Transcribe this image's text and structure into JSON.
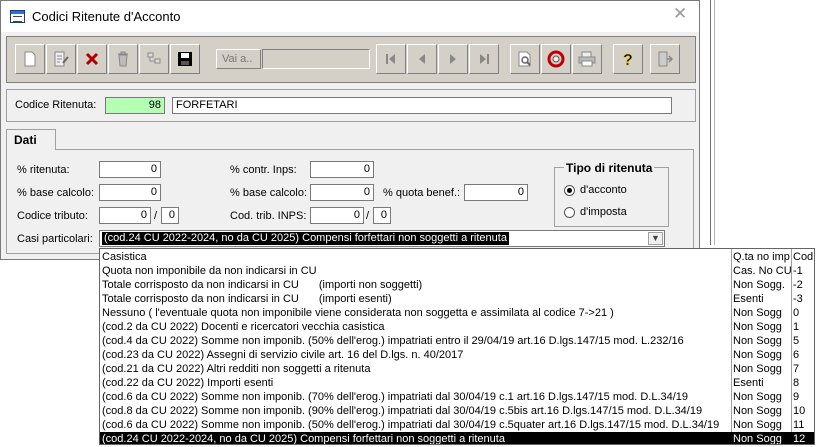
{
  "window": {
    "title": "Codici Ritenute d'Acconto",
    "close_glyph": "✕"
  },
  "toolbar": {
    "buttons": [
      {
        "name": "new-record-icon"
      },
      {
        "name": "edit-record-icon"
      },
      {
        "name": "delete-x-icon"
      },
      {
        "name": "trash-icon"
      },
      {
        "name": "tree-icon"
      },
      {
        "name": "save-floppy-icon"
      },
      {
        "name": "first-record-icon"
      },
      {
        "name": "prev-record-icon"
      },
      {
        "name": "next-record-icon"
      },
      {
        "name": "last-record-icon"
      },
      {
        "name": "preview-search-icon"
      },
      {
        "name": "refresh-icon"
      },
      {
        "name": "print-icon"
      },
      {
        "name": "help-icon"
      },
      {
        "name": "exit-door-icon"
      }
    ],
    "vai_label": "Vai a..",
    "vai_value": ""
  },
  "codice": {
    "label": "Codice Ritenuta:",
    "code": "98",
    "description": "FORFETARI"
  },
  "tab": {
    "label": "Dati"
  },
  "dati": {
    "ritenuta_label": "% ritenuta:",
    "ritenuta_value": "0",
    "base_calcolo_label": "% base calcolo:",
    "base_calcolo_value": "0",
    "codice_tributo_label": "Codice tributo:",
    "codice_tributo_value": "0",
    "codice_tributo_sub": "0",
    "contr_inps_label": "% contr. Inps:",
    "contr_inps_value": "0",
    "base_calcolo2_label": "% base calcolo:",
    "base_calcolo2_value": "0",
    "quota_benef_label": "% quota benef.:",
    "quota_benef_value": "0",
    "cod_trib_inps_label": "Cod. trib. INPS:",
    "cod_trib_inps_value": "0",
    "cod_trib_inps_sub": "0",
    "slash": "/",
    "casi_label": "Casi particolari:",
    "casi_value": "(cod.24 CU 2022-2024, no da CU 2025) Compensi forfettari non soggetti a ritenuta"
  },
  "tipo": {
    "title": "Tipo di ritenuta",
    "options": [
      "d'acconto",
      "d'imposta"
    ],
    "selected": "d'acconto"
  },
  "dropdown": {
    "headers": [
      "Casistica",
      "Q.ta no imp",
      "Cod"
    ],
    "rows": [
      {
        "casistica": "Quota non imponibile da non indicarsi in CU",
        "extra": "",
        "qta": "Cas. No CU",
        "cod": "-1"
      },
      {
        "casistica": "Totale corrisposto da non indicarsi in CU",
        "extra": "(importi non soggetti)",
        "qta": "Non Sogg.",
        "cod": "-2"
      },
      {
        "casistica": "Totale corrisposto da non indicarsi in CU",
        "extra": "(importi esenti)",
        "qta": "Esenti",
        "cod": "-3"
      },
      {
        "casistica": "Nessuno     ( l'eventuale quota non imponibile viene considerata non soggetta e assimilata al codice 7->21 )",
        "extra": "",
        "qta": "Non Sogg",
        "cod": "0"
      },
      {
        "casistica": "(cod.2 da CU 2022) Docenti e ricercatori vecchia casistica",
        "extra": "",
        "qta": "Non Sogg",
        "cod": "1"
      },
      {
        "casistica": "(cod.4 da CU 2022) Somme non imponib. (50% dell'erog.) impatriati entro il 29/04/19 art.16 D.lgs.147/15 mod. L.232/16",
        "extra": "",
        "qta": "Non Sogg",
        "cod": "5"
      },
      {
        "casistica": "(cod.23 da CU 2022) Assegni di servizio civile art. 16 del D.lgs. n. 40/2017",
        "extra": "",
        "qta": "Non Sogg",
        "cod": "6"
      },
      {
        "casistica": "(cod.21 da CU 2022) Altri redditi non soggetti a ritenuta",
        "extra": "",
        "qta": "Non Sogg",
        "cod": "7"
      },
      {
        "casistica": "(cod.22 da CU 2022) Importi esenti",
        "extra": "",
        "qta": "Esenti",
        "cod": "8"
      },
      {
        "casistica": "(cod.6 da CU 2022) Somme non imponib. (70% dell'erog.) impatriati dal 30/04/19 c.1 art.16 D.lgs.147/15 mod. D.L.34/19",
        "extra": "",
        "qta": "Non Sogg",
        "cod": "9"
      },
      {
        "casistica": "(cod.8 da CU 2022) Somme non imponib. (90% dell'erog.) impatriati dal 30/04/19 c.5bis art.16 D.lgs.147/15 mod. D.L.34/19",
        "extra": "",
        "qta": "Non Sogg",
        "cod": "10"
      },
      {
        "casistica": "(cod.6 da CU 2022) Somme non imponib. (50% dell'erog.) impatriati dal 30/04/19 c.5quater art.16 D.lgs.147/15 mod. D.L.34/19",
        "extra": "",
        "qta": "Non Sogg",
        "cod": "11"
      },
      {
        "casistica": "(cod.24 CU 2022-2024, no da CU 2025) Compensi forfettari non soggetti a ritenuta",
        "extra": "",
        "qta": "Non Sogg",
        "cod": "12"
      }
    ],
    "selected_index": 12
  }
}
